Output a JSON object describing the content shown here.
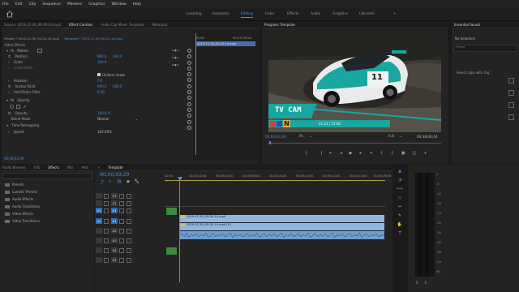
{
  "menu": [
    "File",
    "Edit",
    "Clip",
    "Sequence",
    "Markers",
    "Graphics",
    "Window",
    "Help"
  ],
  "workspaces": [
    "Learning",
    "Assembly",
    "Editing",
    "Color",
    "Effects",
    "Audio",
    "Graphics",
    "Libraries"
  ],
  "active_workspace": "Editing",
  "source_tabs": [
    "Source: 2019-12-30_09-20-10.mp4",
    "Effect Controls",
    "Audio Clip Mixer: Template",
    "Metadata"
  ],
  "effect_controls": {
    "master_label": "Master * 2019-12-30_09-20-10.mp4",
    "sequence_label": "Template * 2019-12-30_09-20-10.mp4",
    "mini_time": "00;00",
    "mini_time_right": "00;17;03;24",
    "clip_name": "2019-12-30_09-20-10.mp4",
    "section": "Video Effects",
    "motion": "Motion",
    "position_label": "Position",
    "position_x": "960.0",
    "position_y": "540.0",
    "scale_label": "Scale",
    "scale_val": "100.0",
    "scale_width_label": "Scale Width",
    "uniform_scale": "Uniform Scale",
    "rotation_label": "Rotation",
    "rotation_val": "0.0",
    "anchor_label": "Anchor Point",
    "anchor_x": "960.0",
    "anchor_y": "540.0",
    "antiflicker_label": "Anti-flicker Filter",
    "antiflicker_val": "0.00",
    "opacity_section": "Opacity",
    "opacity_label": "Opacity",
    "opacity_val": "100.0 %",
    "blend_label": "Blend Mode",
    "blend_val": "Normal",
    "time_remap": "Time Remapping",
    "speed_label": "Speed",
    "speed_val": "100.00%",
    "timecode": "00;00;03;29"
  },
  "program": {
    "tab": "Program: Template",
    "overlay_title": "TV CAM",
    "banner_text": "21:21 | 15:00",
    "timecode_left": "00;00;03;29",
    "fit": "Fit",
    "full": "Full",
    "timecode_right": "00;38;40;44",
    "car_number": "11"
  },
  "project": {
    "tabs": [
      "Audio Browser",
      "Info",
      "Effects",
      "Mar",
      "Hist"
    ],
    "items": [
      "Presets",
      "Lumetri Presets",
      "Audio Effects",
      "Audio Transitions",
      "Video Effects",
      "Video Transitions"
    ]
  },
  "timeline": {
    "tab": "Template",
    "timecode": "00;00;03;29",
    "ruler": [
      "00;00",
      "00;00;02;00",
      "00;00;04;00",
      "00;00;06;00",
      "00;00;08;00",
      "00;00;10;00",
      "00;00;12;00",
      "00;00;14;00",
      "00;00;16;00"
    ],
    "tracks": [
      {
        "id": "V3",
        "side": "",
        "target": false
      },
      {
        "id": "V2",
        "side": "",
        "target": false
      },
      {
        "id": "V1",
        "side": "V1",
        "target": true
      },
      {
        "id": "A1",
        "side": "A1",
        "target": true
      },
      {
        "id": "A2",
        "side": "",
        "target": false
      },
      {
        "id": "A3",
        "side": "",
        "target": false
      },
      {
        "id": "A4",
        "side": "",
        "target": false
      },
      {
        "id": "A5",
        "side": "",
        "target": false
      }
    ],
    "clip_v2": "2019-12-30_09-20-10.mp4",
    "clip_v1": "2019-12-30_09-20-10.mp4 [V]"
  },
  "essential": {
    "title": "Essential Sound",
    "no_selection": "No Selection",
    "preset": "Preset",
    "tag_label": "Select clips with Tag:"
  },
  "audio_meter": {
    "labels": [
      "0",
      "-6",
      "-12",
      "-18",
      "-24",
      "-30",
      "-36",
      "-42",
      "-48",
      "-54",
      "dB"
    ]
  },
  "colors": {
    "accent": "#4a90e2",
    "clip_video": "#8fb6e0",
    "clip_audio": "#6e9dcf",
    "playhead": "#4a90e2",
    "teal": "#1aa6a0"
  }
}
